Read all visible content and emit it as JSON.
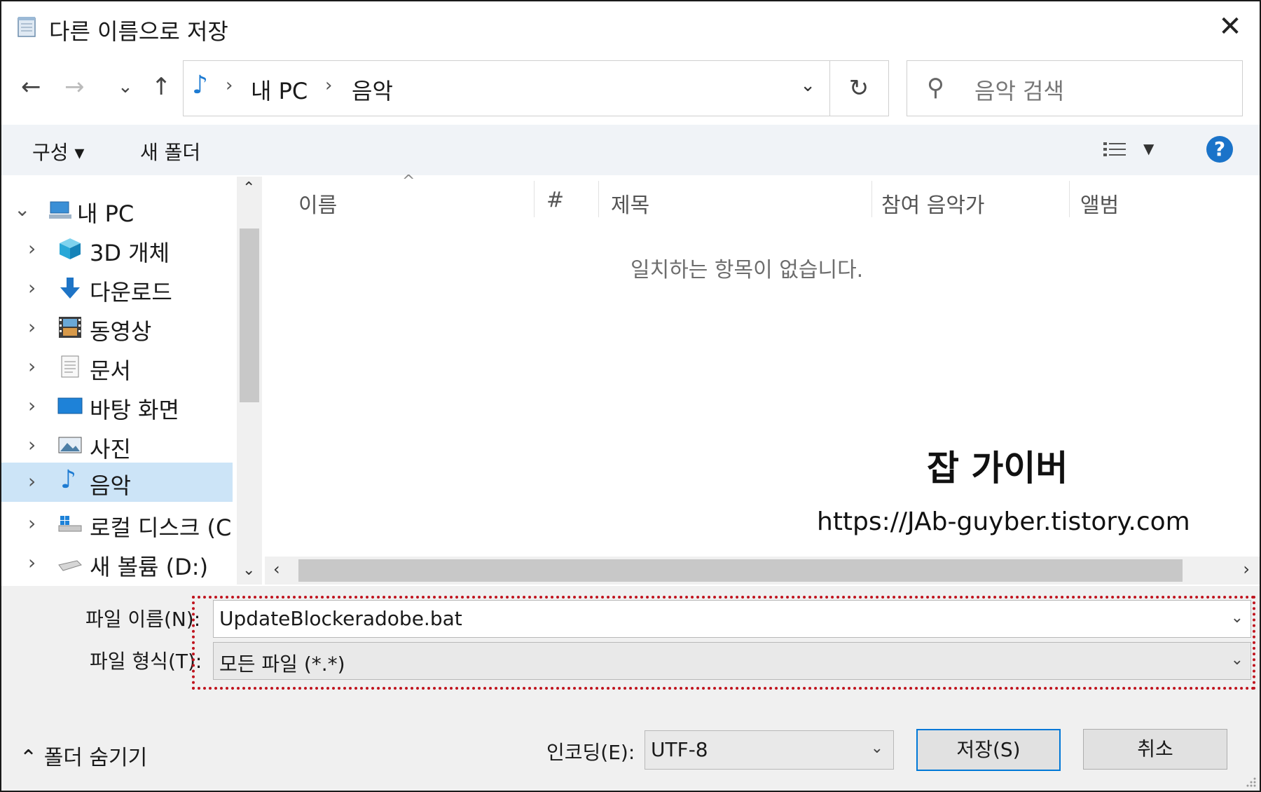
{
  "window": {
    "title": "다른 이름으로 저장",
    "close_glyph": "✕"
  },
  "nav": {
    "back_glyph": "←",
    "forward_glyph": "→",
    "recent_glyph": "⌄",
    "up_glyph": "↑",
    "breadcrumb": [
      "내 PC",
      "음악"
    ],
    "breadcrumb_sep": "›",
    "refresh_glyph": "↻",
    "search_placeholder": "음악 검색"
  },
  "toolbar": {
    "organize": "구성 ▾",
    "new_folder": "새 폴더",
    "help": "?"
  },
  "tree": {
    "root": "내 PC",
    "items": [
      "3D 개체",
      "다운로드",
      "동영상",
      "문서",
      "바탕 화면",
      "사진",
      "음악",
      "로컬 디스크 (C",
      "새 볼륨 (D:)"
    ],
    "selected_index": 6
  },
  "columns": [
    "이름",
    "#",
    "제목",
    "참여 음악가",
    "앨범"
  ],
  "empty_message": "일치하는 항목이 없습니다.",
  "watermark": {
    "title": "잡 가이버",
    "url": "https://JAb-guyber.tistory.com"
  },
  "form": {
    "filename_label": "파일 이름(N):",
    "filename_value": "UpdateBlockeradobe.bat",
    "filetype_label": "파일 형식(T):",
    "filetype_value": "모든 파일 (*.*)",
    "hide_folders": "폴더 숨기기",
    "encoding_label": "인코딩(E):",
    "encoding_value": "UTF-8",
    "save_button": "저장(S)",
    "cancel_button": "취소"
  },
  "colors": {
    "accent": "#0078d7",
    "selection": "#cce4f7",
    "highlight_box": "#c0141e"
  }
}
